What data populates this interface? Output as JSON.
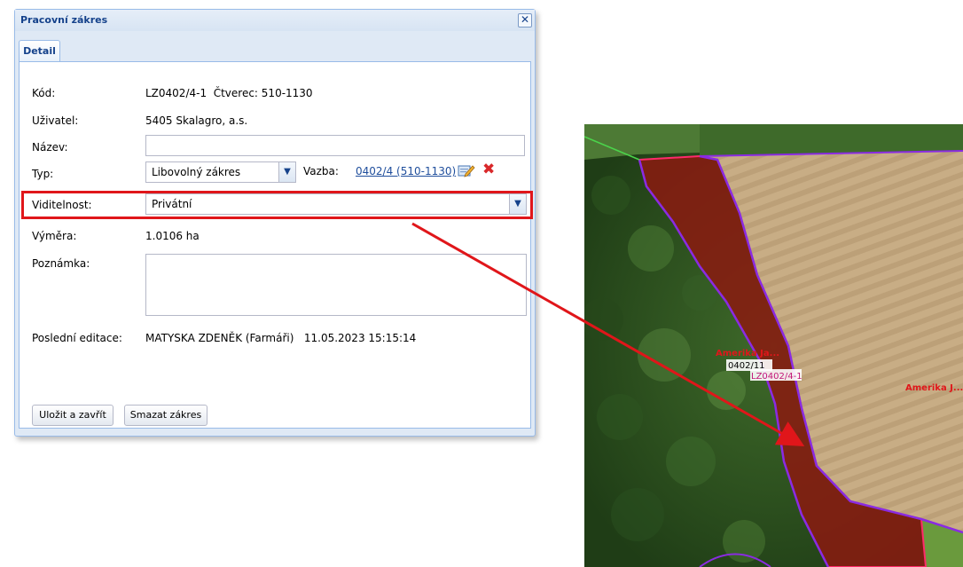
{
  "dialog": {
    "title": "Pracovní zákres",
    "close_symbol": "✕",
    "tab_detail": "Detail"
  },
  "form": {
    "kod_label": "Kód:",
    "kod_value": "LZ0402/4-1  Čtverec: 510-1130",
    "uzivatel_label": "Uživatel:",
    "uzivatel_value": "5405 Skalagro, a.s.",
    "nazev_label": "Název:",
    "nazev_value": "",
    "typ_label": "Typ:",
    "typ_value": "Libovolný zákres",
    "vazba_label": "Vazba:",
    "vazba_link": "0402/4 (510-1130)",
    "viditelnost_label": "Viditelnost:",
    "viditelnost_value": "Privátní",
    "vymera_label": "Výměra:",
    "vymera_value": "1.0106 ha",
    "poznamka_label": "Poznámka:",
    "poznamka_value": "",
    "posledni_label": "Poslední editace:",
    "posledni_value": "MATYSKA ZDENĚK (Farmáři)   11.05.2023 15:15:14"
  },
  "buttons": {
    "save_close": "Uložit a zavřít",
    "delete": "Smazat zákres"
  },
  "map": {
    "label_block": "Amerika Ja...",
    "label_block_left": "Amerika J...",
    "label_code": "0402/11",
    "label_lz": "LZ0402/4-1",
    "label_right": "Amerika J..."
  },
  "icons": {
    "close": "close-icon",
    "combo_arrow": "chevron-down-icon",
    "edit": "pencil-icon",
    "delete": "red-x-icon"
  },
  "colors": {
    "header_text": "#15428b",
    "highlight": "#e0161a",
    "link": "#1f4e9c",
    "parcel_fill": "#8b1a10",
    "parcel_border": "#8a2be2"
  }
}
